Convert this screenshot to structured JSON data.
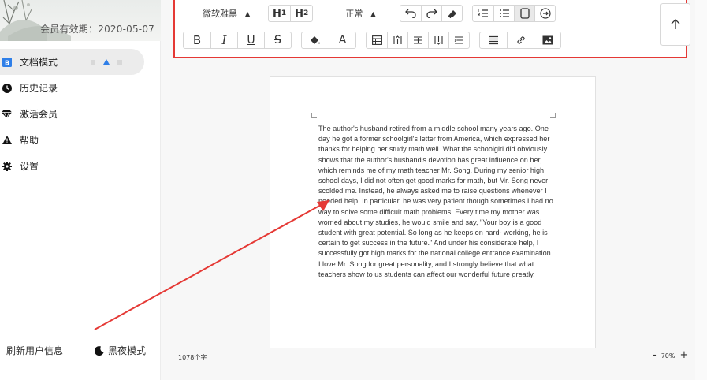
{
  "sidebar": {
    "expiry_text": "会员有效期：2020-05-07",
    "items": [
      {
        "label": "文档模式",
        "icon": "document-icon"
      },
      {
        "label": "历史记录",
        "icon": "clock-icon"
      },
      {
        "label": "激活会员",
        "icon": "diamond-icon"
      },
      {
        "label": "帮助",
        "icon": "warning-icon"
      },
      {
        "label": "设置",
        "icon": "gear-icon"
      }
    ],
    "refresh_label": "刷新用户信息",
    "night_mode_label": "黑夜模式"
  },
  "toolbar": {
    "font_family": "微软雅黑",
    "heading1": "H1",
    "heading2": "H2",
    "paragraph_style": "正常",
    "bold": "B",
    "italic": "I",
    "underline": "U",
    "strikethrough": "S",
    "font_color": "A"
  },
  "document": {
    "text": "The author's husband retired from a middle school many years ago. One day he got a former schoolgirl's letter from America, which expressed her thanks for helping her study math well. What the schoolgirl did obviously shows that the author's husband's devotion has great influence on her, which reminds me of my math teacher Mr. Song. During my senior high school days, I did not often get good marks for math, but Mr. Song never scolded me. Instead, he always asked me to raise questions whenever I needed help. In particular, he was very patient though sometimes I had no way to solve some difficult math problems. Every time my mother was worried about my studies, he would smile and say, \"Your boy is a good student with great potential. So long as he keeps on hard- working, he is certain to get success in the future.\" And under his considerate help, I successfully got high marks for the national college entrance examination. I love Mr. Song for great personality, and I strongly believe that what teachers show to us students can affect our wonderful future greatly."
  },
  "status": {
    "char_count": "1078个字",
    "zoom_minus": "-",
    "zoom_level": "70%",
    "zoom_plus": "+"
  },
  "colors": {
    "accent_blue": "#2f7fe8",
    "highlight_red": "#e53935"
  }
}
